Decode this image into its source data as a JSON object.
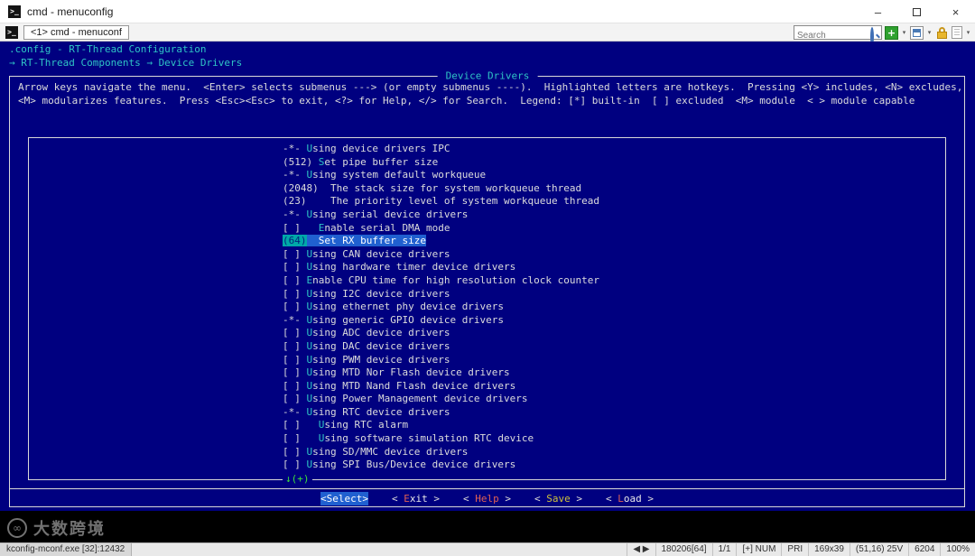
{
  "window": {
    "title": "cmd - menuconfig",
    "console_icon_glyph": ">_",
    "minimize_label": "–",
    "close_label": "×"
  },
  "tabbar": {
    "tab_label": "<1> cmd - menuconf",
    "search_placeholder": "Search",
    "plus_label": "+",
    "dropdown_glyph": "▾"
  },
  "terminal": {
    "path_line": ".config - RT-Thread Configuration",
    "breadcrumb": "→ RT-Thread Components → Device Drivers",
    "dialog": {
      "title": "Device Drivers",
      "instructions_line1": "Arrow keys navigate the menu.  <Enter> selects submenus ---> (or empty submenus ----).  Highlighted letters are hotkeys.  Pressing <Y> includes, <N> excludes,",
      "instructions_line2": "<M> modularizes features.  Press <Esc><Esc> to exit, <?> for Help, </> for Search.  Legend: [*] built-in  [ ] excluded  <M> module  < > module capable",
      "items": [
        {
          "prefix": "-*- ",
          "label": "Using device drivers IPC"
        },
        {
          "prefix": "(512) ",
          "label": "Set pipe buffer size"
        },
        {
          "prefix": "-*- ",
          "label": "Using system default workqueue"
        },
        {
          "prefix": "(2048)  ",
          "label": "The stack size for system workqueue thread",
          "hotkey": false
        },
        {
          "prefix": "(23)    ",
          "label": "The priority level of system workqueue thread",
          "hotkey": false
        },
        {
          "prefix": "-*- ",
          "label": "Using serial device drivers"
        },
        {
          "prefix": "[ ]   ",
          "label": "Enable serial DMA mode"
        },
        {
          "prefix": "(64)  ",
          "label": "Set RX buffer size",
          "selected": true
        },
        {
          "prefix": "[ ] ",
          "label": "Using CAN device drivers"
        },
        {
          "prefix": "[ ] ",
          "label": "Using hardware timer device drivers"
        },
        {
          "prefix": "[ ] ",
          "label": "Enable CPU time for high resolution clock counter"
        },
        {
          "prefix": "[ ] ",
          "label": "Using I2C device drivers"
        },
        {
          "prefix": "[ ] ",
          "label": "Using ethernet phy device drivers"
        },
        {
          "prefix": "-*- ",
          "label": "Using generic GPIO device drivers"
        },
        {
          "prefix": "[ ] ",
          "label": "Using ADC device drivers"
        },
        {
          "prefix": "[ ] ",
          "label": "Using DAC device drivers"
        },
        {
          "prefix": "[ ] ",
          "label": "Using PWM device drivers"
        },
        {
          "prefix": "[ ] ",
          "label": "Using MTD Nor Flash device drivers"
        },
        {
          "prefix": "[ ] ",
          "label": "Using MTD Nand Flash device drivers"
        },
        {
          "prefix": "[ ] ",
          "label": "Using Power Management device drivers"
        },
        {
          "prefix": "-*- ",
          "label": "Using RTC device drivers"
        },
        {
          "prefix": "[ ]   ",
          "label": "Using RTC alarm"
        },
        {
          "prefix": "[ ]   ",
          "label": "Using software simulation RTC device"
        },
        {
          "prefix": "[ ] ",
          "label": "Using SD/MMC device drivers"
        },
        {
          "prefix": "[ ] ",
          "label": "Using SPI Bus/Device device drivers"
        }
      ],
      "scroll_indicator": "↓(+)",
      "buttons": [
        {
          "label": "Select",
          "focused": true
        },
        {
          "label": "Exit",
          "label_color": "#E8E8E8",
          "hotkey_color": "#E06055"
        },
        {
          "label": "Help",
          "label_color": "#E06055",
          "hotkey_color": "#E06055"
        },
        {
          "label": "Save",
          "label_color": "#CFC23A",
          "hotkey_color": "#CFC23A"
        },
        {
          "label": "Load",
          "label_color": "#E8E8E8",
          "hotkey_color": "#E06055"
        }
      ]
    }
  },
  "watermark": {
    "logo": "∞",
    "text": "大数跨境"
  },
  "statusbar": {
    "process": "kconfig-mconf.exe [32]:12432",
    "segments": [
      "◀ ▶",
      "180206[64]",
      "1/1",
      "[+] NUM",
      "PRI",
      "169x39",
      "(51,16) 25V",
      "6204",
      "100%"
    ]
  },
  "colors": {
    "terminal_bg": "#000080",
    "selection_bar": "#2060D0",
    "selection_tag_bg": "#00A8A8",
    "title_cyan": "#2FC5C5",
    "hotkey_cyan": "#2FC5C5",
    "scroll_green": "#3ADF3A",
    "button_red": "#E06055",
    "button_yellow": "#CFC23A"
  }
}
